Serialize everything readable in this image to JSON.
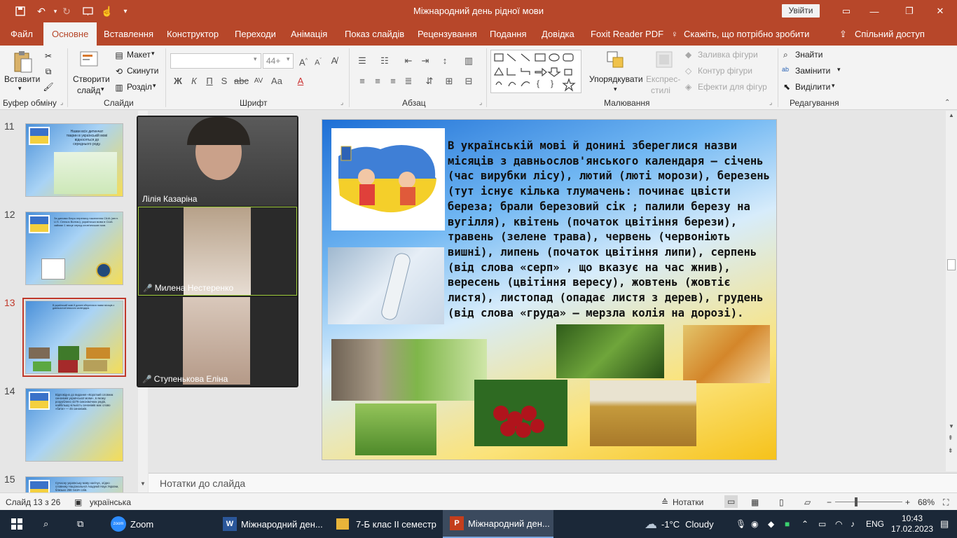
{
  "window": {
    "title": "Міжнародний день рідної мови",
    "signin": "Увійти"
  },
  "tabs": [
    "Файл",
    "Основне",
    "Вставлення",
    "Конструктор",
    "Переходи",
    "Анімація",
    "Показ слайдів",
    "Рецензування",
    "Подання",
    "Довідка",
    "Foxit Reader PDF",
    "Скажіть, що потрібно зробити",
    "Спільний доступ"
  ],
  "ribbon": {
    "clipboard": {
      "paste": "Вставити",
      "label": "Буфер обміну"
    },
    "slides": {
      "new_slide_1": "Створити",
      "new_slide_2": "слайд",
      "layout": "Макет",
      "reset": "Скинути",
      "section": "Розділ",
      "label": "Слайди"
    },
    "font": {
      "name": "",
      "size": "44+",
      "label": "Шрифт"
    },
    "paragraph": {
      "label": "Абзац"
    },
    "drawing": {
      "arrange": "Упорядкувати",
      "quick_styles_1": "Експрес-",
      "quick_styles_2": "стилі",
      "fill": "Заливка фігури",
      "outline": "Контур фігури",
      "effects": "Ефекти для фігур",
      "label": "Малювання"
    },
    "editing": {
      "find": "Знайти",
      "replace": "Замінити",
      "select": "Виділити",
      "label": "Редагування"
    }
  },
  "thumbnails": [
    {
      "num": "11",
      "text": "Назви всіх дитинчат тварин в українській мові відносяться до середнього роду."
    },
    {
      "num": "12",
      "text": "За даними Бюро перепису населення США (англ. U.S. Census Bureau), українська мова в США займає 1 місце серед слов'янських мов."
    },
    {
      "num": "13",
      "text": "В українській мові й донині збереглися назви місяців з давньослов'янського календаря."
    },
    {
      "num": "14",
      "text": "Відповідно до видання «Короткий словник синонімів української мови», в якому розроблено 4279 синонімічних рядів, найбільшу кількість синонімів має слово «бити» — 45 синонімів."
    },
    {
      "num": "15",
      "text": "Сучасну українську мову налічує, згідно словнику Національної Академії Наук України, близько 256 тисяч слів."
    }
  ],
  "zoom": {
    "participants": [
      {
        "name": "Лілія Казаріна",
        "muted": false
      },
      {
        "name": "Милена Нестеренко",
        "muted": true
      },
      {
        "name": "Ступенькова Еліна",
        "muted": true
      }
    ]
  },
  "slide": {
    "text": "В українській мові й донині збереглися назви місяців з давньослов'янського календаря — січень (час вирубки лісу), лютий (люті морози), березень (тут існує кілька тлумачень: починає цвісти береза; брали березовий сік ; палили березу на вугілля), квітень (початок цвітіння берези), травень (зелене трава), червень (червоніють вишні), липень (початок цвітіння липи), серпень (від слова «серп» , що вказує на час жнив), вересень (цвітіння вересу), жовтень (жовтіє листя), листопад (опадає листя з дерев), грудень (від слова «груда» — мерзла колія на дорозі)."
  },
  "notes": {
    "placeholder": "Нотатки до слайда"
  },
  "status": {
    "slide": "Слайд 13 з 26",
    "language": "українська",
    "notes": "Нотатки",
    "zoom": "68%"
  },
  "taskbar": {
    "zoom_app": "Zoom",
    "word": "Міжнародний ден...",
    "folder": "7-Б клас II семестр",
    "powerpoint": "Міжнародний ден...",
    "weather_temp": "-1°C",
    "weather_text": "Cloudy",
    "lang": "ENG",
    "time": "10:43",
    "date": "17.02.2023"
  },
  "colors": {
    "accent": "#b7472a",
    "selection": "#c0392b",
    "taskbar": "#1b2838"
  }
}
